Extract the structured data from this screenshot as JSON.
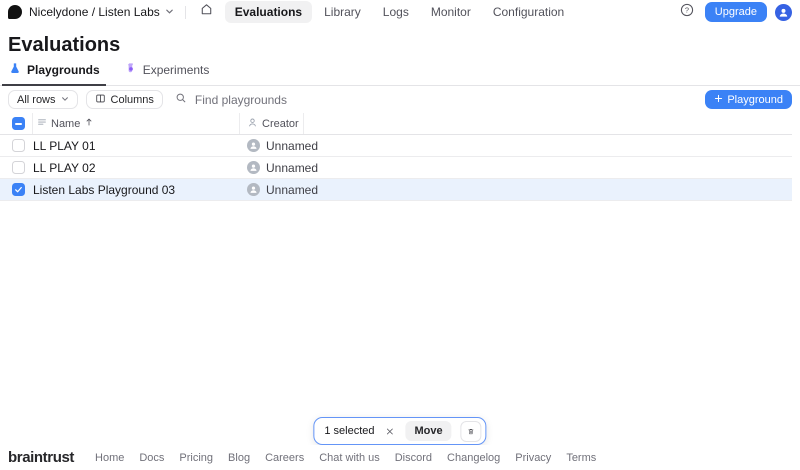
{
  "header": {
    "workspace_label": "Nicelydone / Listen Labs",
    "nav": [
      {
        "label": "Evaluations",
        "active": true
      },
      {
        "label": "Library",
        "active": false
      },
      {
        "label": "Logs",
        "active": false
      },
      {
        "label": "Monitor",
        "active": false
      },
      {
        "label": "Configuration",
        "active": false
      }
    ],
    "upgrade_label": "Upgrade"
  },
  "page_title": "Evaluations",
  "tabs": [
    {
      "label": "Playgrounds",
      "active": true,
      "icon": "playgrounds-flask-icon",
      "accent": "#3b82f6"
    },
    {
      "label": "Experiments",
      "active": false,
      "icon": "experiments-beaker-icon",
      "accent": "#8b5cf6"
    }
  ],
  "toolbar": {
    "rows_filter_label": "All rows",
    "columns_label": "Columns",
    "search_placeholder": "Find playgrounds",
    "create_label": "Playground"
  },
  "table": {
    "columns": [
      {
        "label": "Name",
        "sorted": "asc"
      },
      {
        "label": "Creator"
      }
    ],
    "rows": [
      {
        "name": "LL PLAY 01",
        "creator": "Unnamed",
        "selected": false
      },
      {
        "name": "LL PLAY 02",
        "creator": "Unnamed",
        "selected": false
      },
      {
        "name": "Listen Labs Playground 03",
        "creator": "Unnamed",
        "selected": true
      }
    ]
  },
  "selection_bar": {
    "status": "1 selected",
    "move_label": "Move"
  },
  "footer": {
    "brand": "braintrust",
    "links": [
      "Home",
      "Docs",
      "Pricing",
      "Blog",
      "Careers",
      "Chat with us",
      "Discord",
      "Changelog",
      "Privacy",
      "Terms"
    ]
  },
  "colors": {
    "accent": "#3b82f6",
    "experiments_accent": "#8b5cf6",
    "selected_row": "#eaf2fd"
  }
}
